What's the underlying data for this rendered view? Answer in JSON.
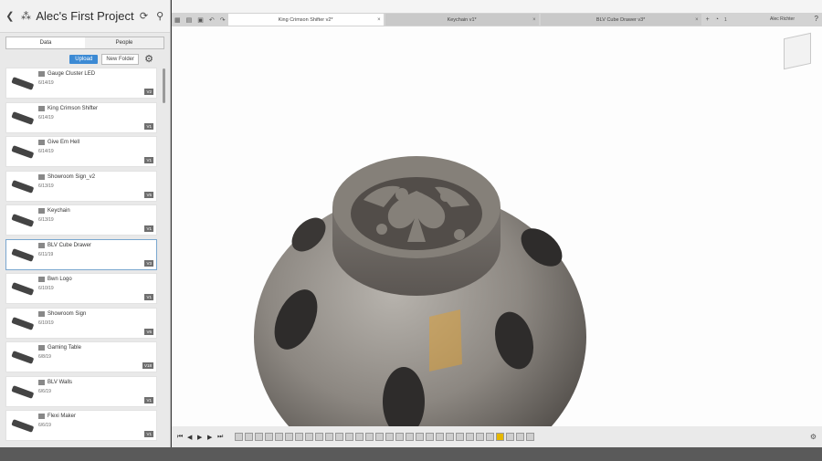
{
  "project": {
    "title": "Alec's First Project"
  },
  "panel_tabs": [
    {
      "label": "Data",
      "active": true
    },
    {
      "label": "People",
      "active": false
    }
  ],
  "buttons": {
    "upload": "Upload",
    "new_folder": "New Folder"
  },
  "files": [
    {
      "name": "Gauge Cluster LED",
      "date": "6/14/19",
      "version": "V2",
      "selected": false,
      "icon": "bar-thumb"
    },
    {
      "name": "King Crimson Shifter",
      "date": "6/14/19",
      "version": "V1",
      "selected": false,
      "icon": "knob-thumb"
    },
    {
      "name": "Give Em Hell",
      "date": "6/14/19",
      "version": "V1",
      "selected": false,
      "icon": "chain-thumb"
    },
    {
      "name": "Showroom Sign_v2",
      "date": "6/13/19",
      "version": "V5",
      "selected": false,
      "icon": "hex-thumb"
    },
    {
      "name": "Keychain",
      "date": "6/13/19",
      "version": "V1",
      "selected": false,
      "icon": "keychain-thumb"
    },
    {
      "name": "BLV Cube Drawer",
      "date": "6/11/19",
      "version": "V3",
      "selected": true,
      "icon": "drawer-thumb"
    },
    {
      "name": "Bwn Logo",
      "date": "6/10/19",
      "version": "V1",
      "selected": false,
      "icon": "logo-thumb"
    },
    {
      "name": "Showroom Sign",
      "date": "6/10/19",
      "version": "V6",
      "selected": false,
      "icon": "hex-thumb"
    },
    {
      "name": "Gaming Table",
      "date": "6/8/19",
      "version": "V18",
      "selected": false,
      "icon": "table-thumb"
    },
    {
      "name": "BLV Walls",
      "date": "6/6/19",
      "version": "V1",
      "selected": false,
      "icon": "walls-thumb"
    },
    {
      "name": "Flexi Maker",
      "date": "6/6/19",
      "version": "V1",
      "selected": false,
      "icon": "bar-thumb"
    }
  ],
  "doc_tabs": [
    {
      "label": "King Crimson Shifter v2*",
      "active": true
    },
    {
      "label": "Keychain v1*",
      "active": false
    },
    {
      "label": "BLV Cube Drawer v3*",
      "active": false
    }
  ],
  "user": {
    "name": "Alec Richter",
    "job_count": "1"
  },
  "colors": {
    "accent": "#3c8ad4",
    "selected_border": "#7aa7cf",
    "feature_highlight": "#e6b800"
  }
}
